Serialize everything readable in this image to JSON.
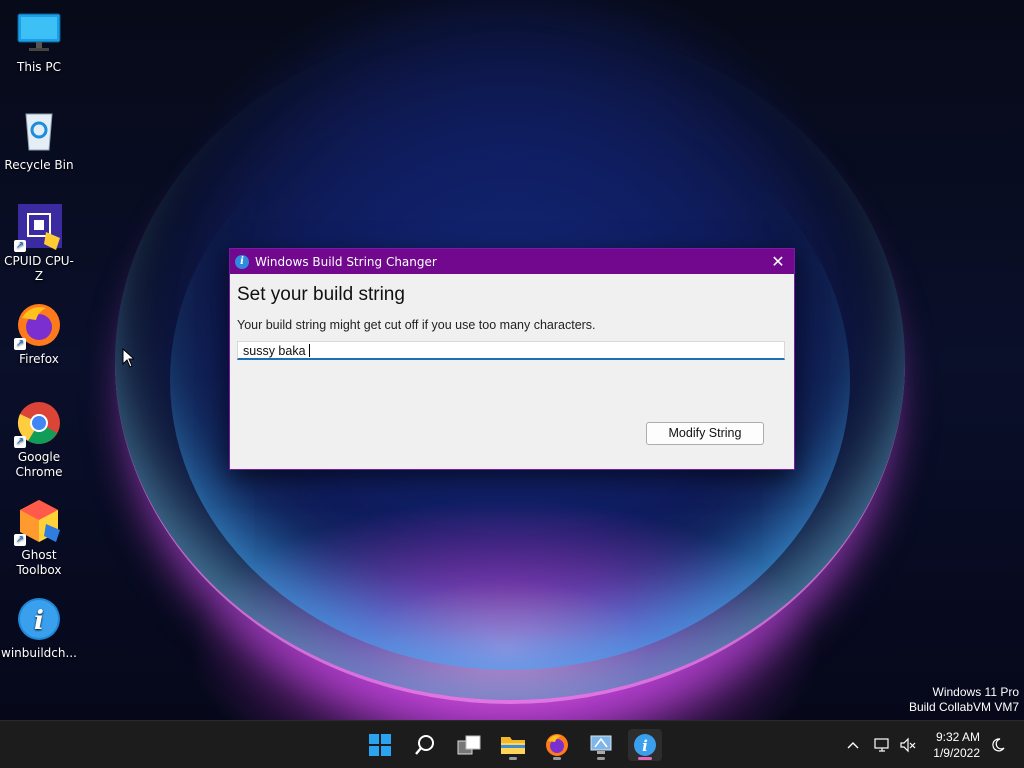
{
  "desktop": {
    "icons": [
      {
        "label": "This PC",
        "icon": "monitor-icon"
      },
      {
        "label": "Recycle Bin",
        "icon": "recycle-bin-icon"
      },
      {
        "label": "CPUID CPU-Z",
        "icon": "cpu-z-icon"
      },
      {
        "label": "Firefox",
        "icon": "firefox-icon"
      },
      {
        "label": "Google\nChrome",
        "icon": "chrome-icon"
      },
      {
        "label": "Ghost\nToolbox",
        "icon": "ghost-toolbox-icon"
      },
      {
        "label": "winbuildch...",
        "icon": "info-icon"
      }
    ],
    "watermark": {
      "line1": "Windows 11 Pro",
      "line2": "Build CollabVM VM7"
    }
  },
  "window": {
    "title": "Windows Build String Changer",
    "heading": "Set your build string",
    "hint": "Your build string might get cut off if you use too many characters.",
    "input_value": "sussy baka",
    "button_label": "Modify String",
    "accent": "#71088e"
  },
  "taskbar": {
    "apps": [
      "start-icon",
      "search-icon",
      "task-view-icon",
      "file-explorer-icon",
      "firefox-icon",
      "remote-desktop-icon",
      "winbuildchanger-icon"
    ],
    "clock": {
      "time": "9:32 AM",
      "date": "1/9/2022"
    }
  }
}
